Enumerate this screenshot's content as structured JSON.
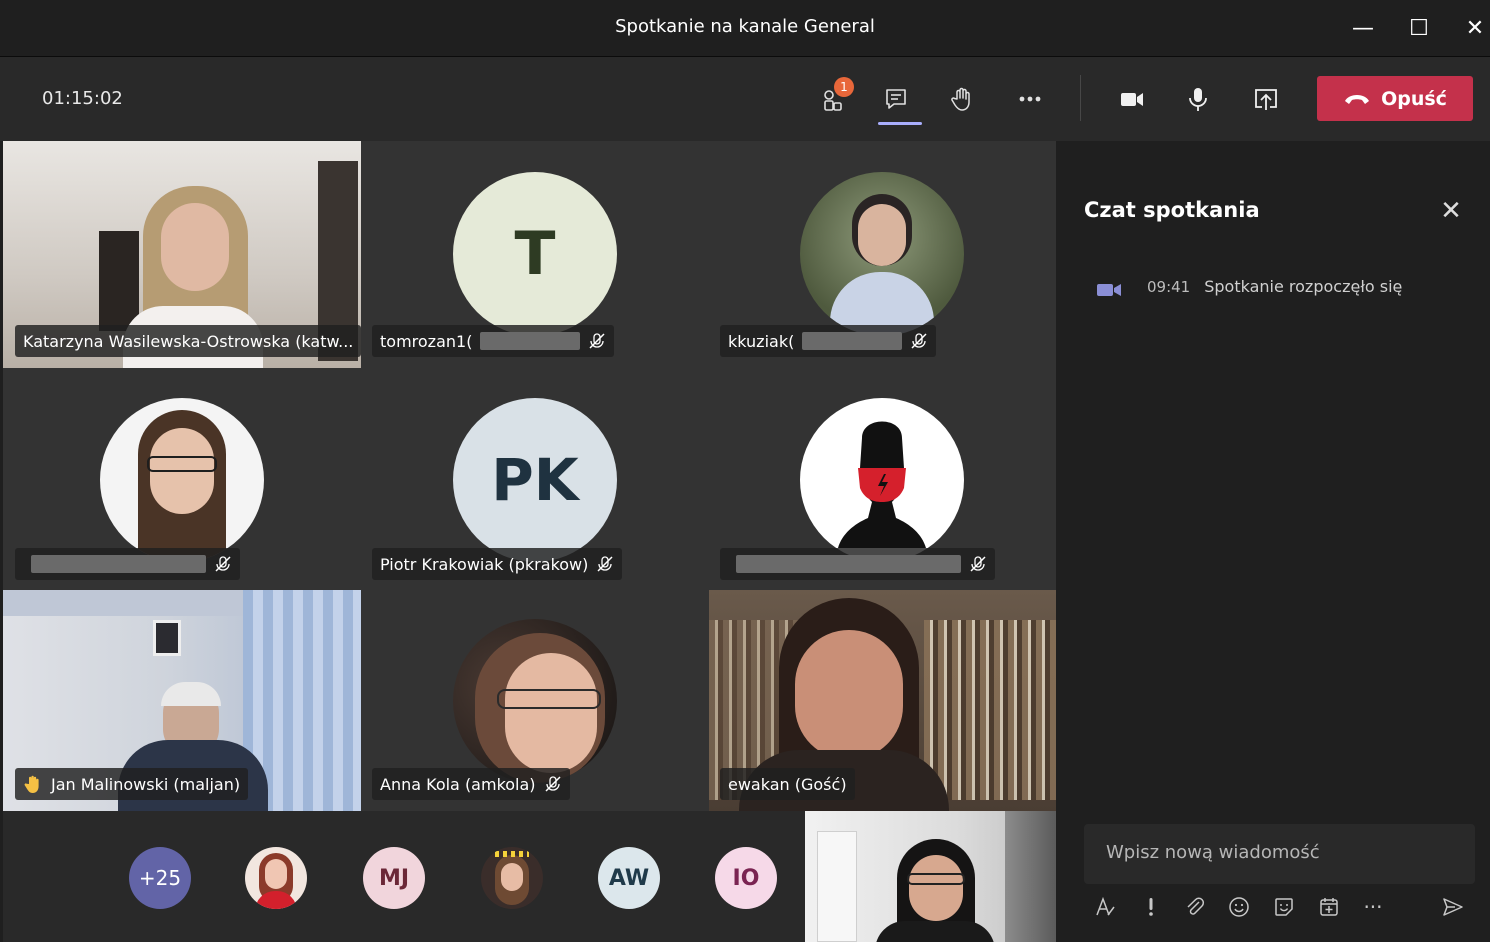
{
  "window": {
    "title": "Spotkanie na kanale General",
    "minimize_label": "—",
    "maximize_label": "☐",
    "close_label": "✕"
  },
  "toolbar": {
    "timer": "01:15:02",
    "participants_badge": "1",
    "leave_label": "Opuść"
  },
  "tiles": [
    {
      "name": "Katarzyna Wasilewska-Ostrowska (katw..."
    },
    {
      "name": "tomrozan1(",
      "initials": "T"
    },
    {
      "name": "kkuziak("
    },
    {
      "name": ""
    },
    {
      "name": "Piotr Krakowiak (pkrakow)",
      "initials": "PK"
    },
    {
      "name": ""
    },
    {
      "name": "Jan Malinowski (maljan)"
    },
    {
      "name": "Anna Kola (amkola)"
    },
    {
      "name": "ewakan (Gość)"
    }
  ],
  "strip": {
    "overflow": "+25",
    "initials": [
      "MJ",
      "AW",
      "IO"
    ]
  },
  "chat": {
    "title": "Czat spotkania",
    "close": "✕",
    "system_time": "09:41",
    "system_text": "Spotkanie rozpoczęło się",
    "placeholder": "Wpisz nową wiadomość",
    "more": "···"
  },
  "colors": {
    "leave": "#c4314b",
    "accent": "#a9aefc",
    "badge": "#e8673a"
  }
}
